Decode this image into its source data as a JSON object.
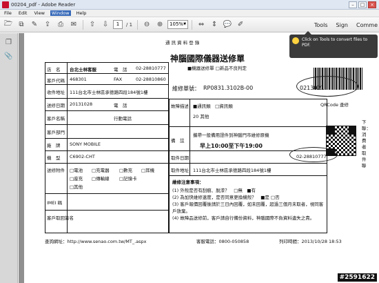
{
  "window": {
    "title": "00204_pdf - Adobe Reader"
  },
  "menu": {
    "items": [
      "File",
      "Edit",
      "View",
      "Window",
      "Help"
    ],
    "active": "Window"
  },
  "toolbar": {
    "page_current": "1",
    "page_total": "/ 1",
    "zoom": "105%",
    "tools": "Tools",
    "sign": "Sign",
    "comment": "Comme"
  },
  "tooltip": {
    "text": "Click on Tools to convert files to PDF."
  },
  "doc": {
    "header_small": "通 訊 資 料 登 錄",
    "company": "神腦國際儀器送修單",
    "options": "■機器送修單 □新品不良判定",
    "repair_no_label": "維修單號：",
    "repair_no": "RP0831.3102B-00",
    "receipt_no": "0213021",
    "store_label": "店　名",
    "store_value": "台北士林客服",
    "tel_label": "電　話",
    "tel_value": "02-28810777",
    "store_code_label": "客戶代碼",
    "store_code_value": "468301",
    "fax_label": "FAX",
    "fax_value": "02-28810860",
    "addr_label": "收件地址",
    "addr_value": "111台北市士林區承德路四段184號1樓",
    "date_label": "送修日期",
    "date_value": "20131028",
    "phone_label": "電　話",
    "customer_label": "客戶名稱",
    "mobile_label": "行動電話",
    "customer_dept_label": "客戶部門",
    "brand_label": "廠　牌",
    "brand_value": "SONY MOBILE",
    "model_label": "機　型",
    "model_value": "C6902-CHT",
    "accessory_label": "送修附件",
    "accessories": [
      "□電池",
      "□充電器",
      "□數充",
      "□耳機",
      "□座充",
      "□傳輸線",
      "□記憶卡",
      "□其他"
    ],
    "imei_label": "IMEI 碼",
    "cust_sign_label": "客戶取回簽名",
    "fault_label": "故障描述",
    "fault_options": "■通訊類　□資訊類",
    "fault_code": "20 其他",
    "remark_label": "備　註",
    "remark_text": "攜帶一般備用證件到神腦門市維修原機",
    "pickup_label": "取件日期",
    "pickup_hours": "早上10:00至下午19:00",
    "pickup_addr_label": "取件地址",
    "pickup_addr": "111台北市士林區承德路四段184號1樓",
    "pickup_phone": "02-28810777",
    "qr_label": "QRCode 查修",
    "notes_title": "維修注意事項：",
    "notes": [
      "(1) 外殼是否有刮痕、脫漆？　□無　■有",
      "(2) 為加快維修速度，是否同意更換機殼？　■是 □否",
      "(3) 客戶報價回覆後請於三日內回覆，如未回覆，超過三個月未取者，視同客戶放棄。",
      "(4) 故障品送修前，客戶請自行備份資料，神腦國際不負資料遺失之責。"
    ],
    "right_side_text": "下聯：消費者取件聯",
    "footer_url": "查詢網址：http://www.senao.com.tw/MT_.aspx",
    "footer_service": "客服電話：0800-050858",
    "footer_print": "列印時間：2013/10/28 18:53"
  },
  "watermark": "#2591622"
}
